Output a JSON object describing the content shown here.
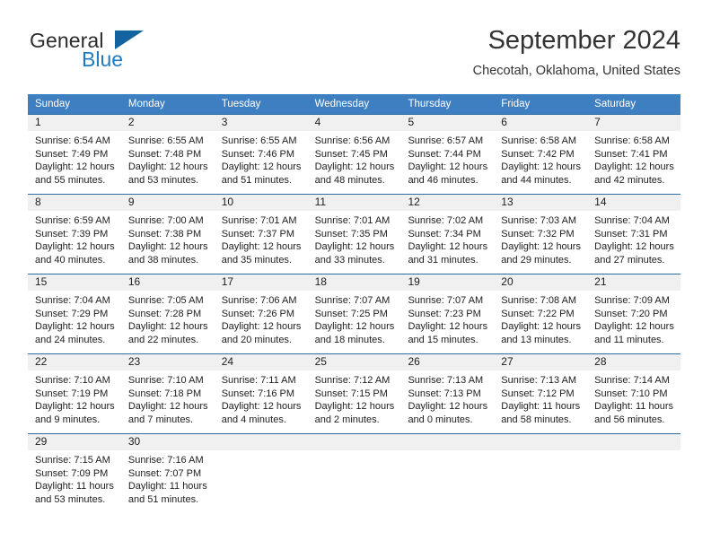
{
  "brand": {
    "name_part1": "General",
    "name_part2": "Blue",
    "flag_icon": "triangle-flag-icon",
    "accent_color": "#1f7bc1"
  },
  "header": {
    "title": "September 2024",
    "subtitle": "Checotah, Oklahoma, United States"
  },
  "calendar": {
    "header_bg": "#3d7fc1",
    "row_border_color": "#2e6da4",
    "day_strip_bg": "#f0f0f0",
    "weekdays": [
      "Sunday",
      "Monday",
      "Tuesday",
      "Wednesday",
      "Thursday",
      "Friday",
      "Saturday"
    ],
    "weeks": [
      [
        {
          "day": "1",
          "sunrise": "Sunrise: 6:54 AM",
          "sunset": "Sunset: 7:49 PM",
          "daylight_line1": "Daylight: 12 hours",
          "daylight_line2": "and 55 minutes."
        },
        {
          "day": "2",
          "sunrise": "Sunrise: 6:55 AM",
          "sunset": "Sunset: 7:48 PM",
          "daylight_line1": "Daylight: 12 hours",
          "daylight_line2": "and 53 minutes."
        },
        {
          "day": "3",
          "sunrise": "Sunrise: 6:55 AM",
          "sunset": "Sunset: 7:46 PM",
          "daylight_line1": "Daylight: 12 hours",
          "daylight_line2": "and 51 minutes."
        },
        {
          "day": "4",
          "sunrise": "Sunrise: 6:56 AM",
          "sunset": "Sunset: 7:45 PM",
          "daylight_line1": "Daylight: 12 hours",
          "daylight_line2": "and 48 minutes."
        },
        {
          "day": "5",
          "sunrise": "Sunrise: 6:57 AM",
          "sunset": "Sunset: 7:44 PM",
          "daylight_line1": "Daylight: 12 hours",
          "daylight_line2": "and 46 minutes."
        },
        {
          "day": "6",
          "sunrise": "Sunrise: 6:58 AM",
          "sunset": "Sunset: 7:42 PM",
          "daylight_line1": "Daylight: 12 hours",
          "daylight_line2": "and 44 minutes."
        },
        {
          "day": "7",
          "sunrise": "Sunrise: 6:58 AM",
          "sunset": "Sunset: 7:41 PM",
          "daylight_line1": "Daylight: 12 hours",
          "daylight_line2": "and 42 minutes."
        }
      ],
      [
        {
          "day": "8",
          "sunrise": "Sunrise: 6:59 AM",
          "sunset": "Sunset: 7:39 PM",
          "daylight_line1": "Daylight: 12 hours",
          "daylight_line2": "and 40 minutes."
        },
        {
          "day": "9",
          "sunrise": "Sunrise: 7:00 AM",
          "sunset": "Sunset: 7:38 PM",
          "daylight_line1": "Daylight: 12 hours",
          "daylight_line2": "and 38 minutes."
        },
        {
          "day": "10",
          "sunrise": "Sunrise: 7:01 AM",
          "sunset": "Sunset: 7:37 PM",
          "daylight_line1": "Daylight: 12 hours",
          "daylight_line2": "and 35 minutes."
        },
        {
          "day": "11",
          "sunrise": "Sunrise: 7:01 AM",
          "sunset": "Sunset: 7:35 PM",
          "daylight_line1": "Daylight: 12 hours",
          "daylight_line2": "and 33 minutes."
        },
        {
          "day": "12",
          "sunrise": "Sunrise: 7:02 AM",
          "sunset": "Sunset: 7:34 PM",
          "daylight_line1": "Daylight: 12 hours",
          "daylight_line2": "and 31 minutes."
        },
        {
          "day": "13",
          "sunrise": "Sunrise: 7:03 AM",
          "sunset": "Sunset: 7:32 PM",
          "daylight_line1": "Daylight: 12 hours",
          "daylight_line2": "and 29 minutes."
        },
        {
          "day": "14",
          "sunrise": "Sunrise: 7:04 AM",
          "sunset": "Sunset: 7:31 PM",
          "daylight_line1": "Daylight: 12 hours",
          "daylight_line2": "and 27 minutes."
        }
      ],
      [
        {
          "day": "15",
          "sunrise": "Sunrise: 7:04 AM",
          "sunset": "Sunset: 7:29 PM",
          "daylight_line1": "Daylight: 12 hours",
          "daylight_line2": "and 24 minutes."
        },
        {
          "day": "16",
          "sunrise": "Sunrise: 7:05 AM",
          "sunset": "Sunset: 7:28 PM",
          "daylight_line1": "Daylight: 12 hours",
          "daylight_line2": "and 22 minutes."
        },
        {
          "day": "17",
          "sunrise": "Sunrise: 7:06 AM",
          "sunset": "Sunset: 7:26 PM",
          "daylight_line1": "Daylight: 12 hours",
          "daylight_line2": "and 20 minutes."
        },
        {
          "day": "18",
          "sunrise": "Sunrise: 7:07 AM",
          "sunset": "Sunset: 7:25 PM",
          "daylight_line1": "Daylight: 12 hours",
          "daylight_line2": "and 18 minutes."
        },
        {
          "day": "19",
          "sunrise": "Sunrise: 7:07 AM",
          "sunset": "Sunset: 7:23 PM",
          "daylight_line1": "Daylight: 12 hours",
          "daylight_line2": "and 15 minutes."
        },
        {
          "day": "20",
          "sunrise": "Sunrise: 7:08 AM",
          "sunset": "Sunset: 7:22 PM",
          "daylight_line1": "Daylight: 12 hours",
          "daylight_line2": "and 13 minutes."
        },
        {
          "day": "21",
          "sunrise": "Sunrise: 7:09 AM",
          "sunset": "Sunset: 7:20 PM",
          "daylight_line1": "Daylight: 12 hours",
          "daylight_line2": "and 11 minutes."
        }
      ],
      [
        {
          "day": "22",
          "sunrise": "Sunrise: 7:10 AM",
          "sunset": "Sunset: 7:19 PM",
          "daylight_line1": "Daylight: 12 hours",
          "daylight_line2": "and 9 minutes."
        },
        {
          "day": "23",
          "sunrise": "Sunrise: 7:10 AM",
          "sunset": "Sunset: 7:18 PM",
          "daylight_line1": "Daylight: 12 hours",
          "daylight_line2": "and 7 minutes."
        },
        {
          "day": "24",
          "sunrise": "Sunrise: 7:11 AM",
          "sunset": "Sunset: 7:16 PM",
          "daylight_line1": "Daylight: 12 hours",
          "daylight_line2": "and 4 minutes."
        },
        {
          "day": "25",
          "sunrise": "Sunrise: 7:12 AM",
          "sunset": "Sunset: 7:15 PM",
          "daylight_line1": "Daylight: 12 hours",
          "daylight_line2": "and 2 minutes."
        },
        {
          "day": "26",
          "sunrise": "Sunrise: 7:13 AM",
          "sunset": "Sunset: 7:13 PM",
          "daylight_line1": "Daylight: 12 hours",
          "daylight_line2": "and 0 minutes."
        },
        {
          "day": "27",
          "sunrise": "Sunrise: 7:13 AM",
          "sunset": "Sunset: 7:12 PM",
          "daylight_line1": "Daylight: 11 hours",
          "daylight_line2": "and 58 minutes."
        },
        {
          "day": "28",
          "sunrise": "Sunrise: 7:14 AM",
          "sunset": "Sunset: 7:10 PM",
          "daylight_line1": "Daylight: 11 hours",
          "daylight_line2": "and 56 minutes."
        }
      ],
      [
        {
          "day": "29",
          "sunrise": "Sunrise: 7:15 AM",
          "sunset": "Sunset: 7:09 PM",
          "daylight_line1": "Daylight: 11 hours",
          "daylight_line2": "and 53 minutes."
        },
        {
          "day": "30",
          "sunrise": "Sunrise: 7:16 AM",
          "sunset": "Sunset: 7:07 PM",
          "daylight_line1": "Daylight: 11 hours",
          "daylight_line2": "and 51 minutes."
        },
        {
          "day": "",
          "sunrise": "",
          "sunset": "",
          "daylight_line1": "",
          "daylight_line2": ""
        },
        {
          "day": "",
          "sunrise": "",
          "sunset": "",
          "daylight_line1": "",
          "daylight_line2": ""
        },
        {
          "day": "",
          "sunrise": "",
          "sunset": "",
          "daylight_line1": "",
          "daylight_line2": ""
        },
        {
          "day": "",
          "sunrise": "",
          "sunset": "",
          "daylight_line1": "",
          "daylight_line2": ""
        },
        {
          "day": "",
          "sunrise": "",
          "sunset": "",
          "daylight_line1": "",
          "daylight_line2": ""
        }
      ]
    ]
  }
}
